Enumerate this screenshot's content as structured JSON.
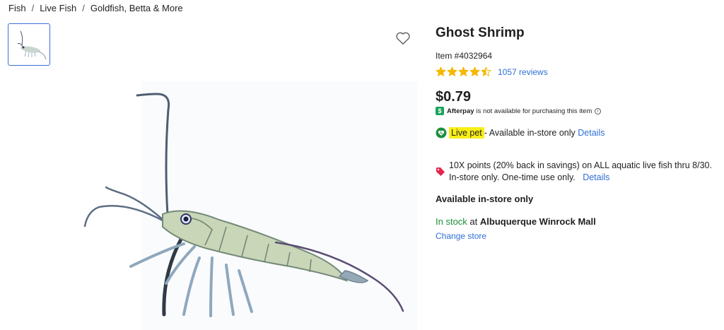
{
  "breadcrumb": {
    "items": [
      "Fish",
      "Live Fish",
      "Goldfish, Betta & More"
    ],
    "separator": "/"
  },
  "gallery": {
    "thumbnail_alt": "Ghost Shrimp thumbnail",
    "favorite_icon": "heart-outline-icon"
  },
  "product": {
    "title": "Ghost Shrimp",
    "item_number": "Item #4032964",
    "rating_value": 4.5,
    "reviews_label": "1057 reviews",
    "price": "$0.79",
    "afterpay_brand": "Afterpay",
    "afterpay_text": "is not available for purchasing this item",
    "live_pet_label": "Live pet",
    "live_pet_text": "- Available in-store only",
    "live_pet_details": "Details",
    "promo_text": "10X points (20% back in savings) on ALL aquatic live fish thru 8/30. In-store only. One-time use only.",
    "promo_details": "Details",
    "availability_heading": "Available in-store only",
    "stock_status": "In stock",
    "stock_at": "at",
    "store_name": "Albuquerque Winrock Mall",
    "change_store": "Change store"
  },
  "colors": {
    "link": "#2f6fd6",
    "star": "#f5b800",
    "in_stock": "#1e8e3e",
    "highlight": "#f8ef16",
    "afterpay": "#1aa35c",
    "tag": "#e5254b",
    "thumb_border": "#3b6fd6"
  }
}
